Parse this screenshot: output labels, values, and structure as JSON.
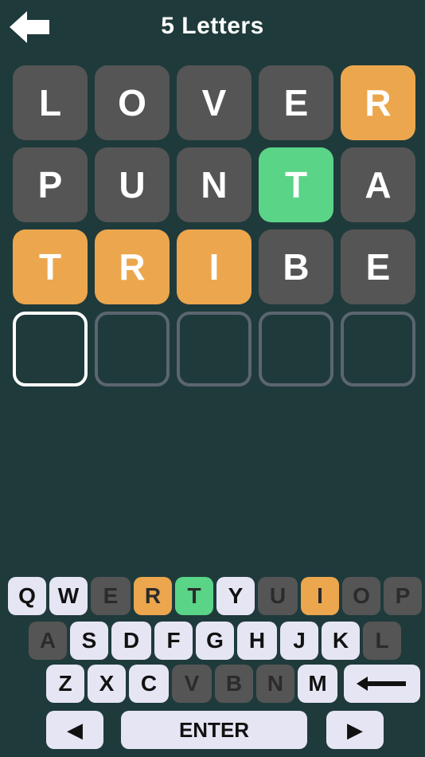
{
  "header": {
    "title": "5 Letters",
    "back_icon": "arrow-left-icon"
  },
  "colors": {
    "background": "#1f3a3b",
    "absent": "#555555",
    "present": "#eca64d",
    "correct": "#5ad487",
    "key": "#e6e5f4"
  },
  "board": {
    "rows": [
      [
        {
          "letter": "L",
          "state": "absent"
        },
        {
          "letter": "O",
          "state": "absent"
        },
        {
          "letter": "V",
          "state": "absent"
        },
        {
          "letter": "E",
          "state": "absent"
        },
        {
          "letter": "R",
          "state": "present"
        }
      ],
      [
        {
          "letter": "P",
          "state": "absent"
        },
        {
          "letter": "U",
          "state": "absent"
        },
        {
          "letter": "N",
          "state": "absent"
        },
        {
          "letter": "T",
          "state": "correct"
        },
        {
          "letter": "A",
          "state": "absent"
        }
      ],
      [
        {
          "letter": "T",
          "state": "present"
        },
        {
          "letter": "R",
          "state": "present"
        },
        {
          "letter": "I",
          "state": "present"
        },
        {
          "letter": "B",
          "state": "absent"
        },
        {
          "letter": "E",
          "state": "absent"
        }
      ],
      [
        {
          "letter": "",
          "state": "active"
        },
        {
          "letter": "",
          "state": "empty"
        },
        {
          "letter": "",
          "state": "empty"
        },
        {
          "letter": "",
          "state": "empty"
        },
        {
          "letter": "",
          "state": "empty"
        }
      ]
    ]
  },
  "keyboard": {
    "row1": [
      {
        "label": "Q",
        "state": "unused"
      },
      {
        "label": "W",
        "state": "unused"
      },
      {
        "label": "E",
        "state": "absent"
      },
      {
        "label": "R",
        "state": "present"
      },
      {
        "label": "T",
        "state": "correct"
      },
      {
        "label": "Y",
        "state": "unused"
      },
      {
        "label": "U",
        "state": "absent"
      },
      {
        "label": "I",
        "state": "present"
      },
      {
        "label": "O",
        "state": "absent"
      },
      {
        "label": "P",
        "state": "absent"
      }
    ],
    "row2": [
      {
        "label": "A",
        "state": "absent"
      },
      {
        "label": "S",
        "state": "unused"
      },
      {
        "label": "D",
        "state": "unused"
      },
      {
        "label": "F",
        "state": "unused"
      },
      {
        "label": "G",
        "state": "unused"
      },
      {
        "label": "H",
        "state": "unused"
      },
      {
        "label": "J",
        "state": "unused"
      },
      {
        "label": "K",
        "state": "unused"
      },
      {
        "label": "L",
        "state": "absent"
      }
    ],
    "row3": [
      {
        "label": "Z",
        "state": "unused"
      },
      {
        "label": "X",
        "state": "unused"
      },
      {
        "label": "C",
        "state": "unused"
      },
      {
        "label": "V",
        "state": "absent"
      },
      {
        "label": "B",
        "state": "absent"
      },
      {
        "label": "N",
        "state": "absent"
      },
      {
        "label": "M",
        "state": "unused"
      }
    ],
    "backspace_icon": "backspace-arrow-icon",
    "left_label": "◀",
    "enter_label": "ENTER",
    "right_label": "▶"
  }
}
